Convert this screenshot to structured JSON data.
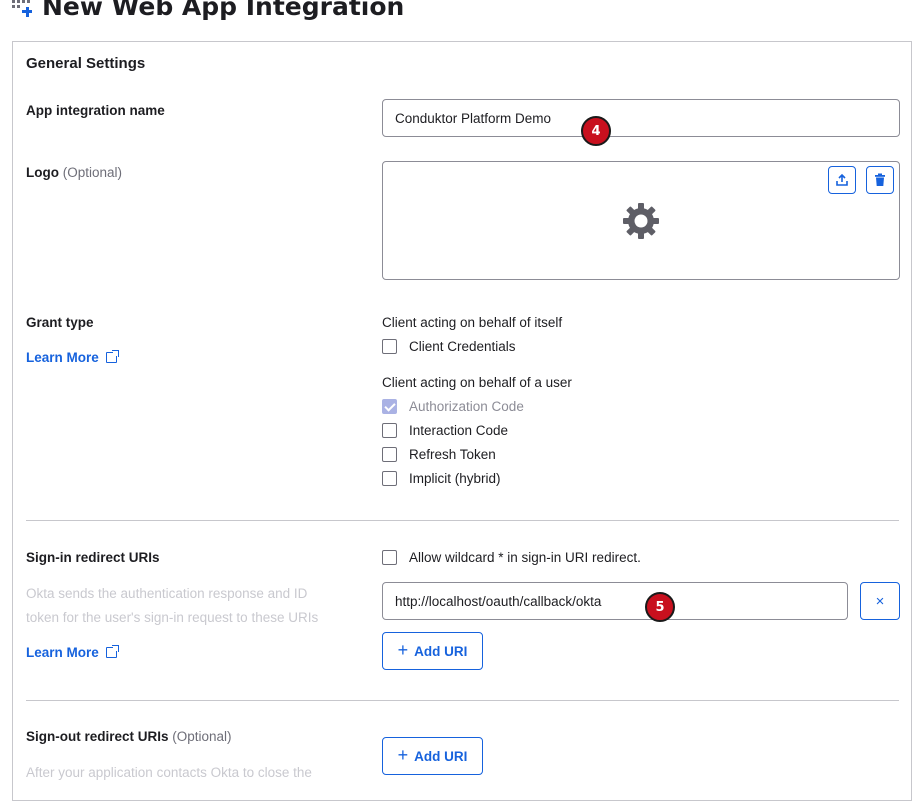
{
  "page": {
    "title": "New Web App Integration"
  },
  "general_settings": {
    "title": "General Settings"
  },
  "app_name": {
    "label": "App integration name",
    "value": "Conduktor Platform Demo",
    "callout": "4"
  },
  "logo": {
    "label": "Logo",
    "optional": "(Optional)"
  },
  "grant_type": {
    "label": "Grant type",
    "learn_more": "Learn More",
    "itself_heading": "Client acting on behalf of itself",
    "client_credentials": "Client Credentials",
    "user_heading": "Client acting on behalf of a user",
    "authorization_code": "Authorization Code",
    "interaction_code": "Interaction Code",
    "refresh_token": "Refresh Token",
    "implicit": "Implicit (hybrid)"
  },
  "signin": {
    "label": "Sign-in redirect URIs",
    "description_line1": "Okta sends the authentication response and ID",
    "description_line2": "token for the user's sign-in request to these URIs",
    "learn_more": "Learn More",
    "wildcard": "Allow wildcard * in sign-in URI redirect.",
    "uri_value": "http://localhost/oauth/callback/okta",
    "callout": "5",
    "add_uri": "Add URI",
    "remove": "×"
  },
  "signout": {
    "label": "Sign-out redirect URIs",
    "optional": "(Optional)",
    "description_line1": "After your application contacts Okta to close the",
    "add_uri": "Add URI"
  },
  "colors": {
    "accent": "#1662dd",
    "callout": "#c8101e"
  }
}
